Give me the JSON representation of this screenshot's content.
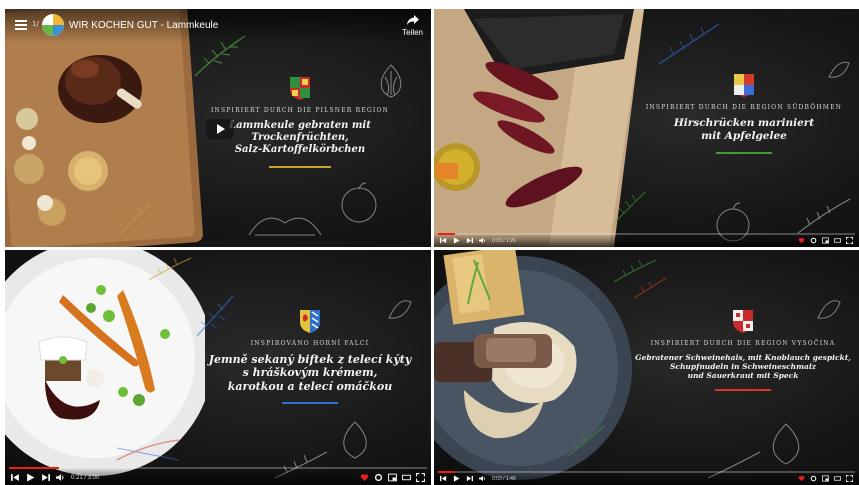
{
  "tiles": [
    {
      "id": "t1",
      "video_title": "WIR KOCHEN GUT - Lammkeule",
      "video_counter": "1/",
      "share_label": "Teilen",
      "kicker": "INSPIRIERT DURCH DIE PILSNER REGION",
      "dish_lines": [
        "Lammkeule gebraten mit Trockenfrüchten,",
        "Salz-Kartoffelkörbchen"
      ],
      "underline_color": "#c9a227"
    },
    {
      "id": "t2",
      "kicker": "INSPIRIERT DURCH DIE REGION SÜDBÖHMEN",
      "dish_lines": [
        "Hirschrücken mariniert",
        "mit Apfelgelee"
      ],
      "underline_color": "#3f9a3a",
      "time": "0:03 / 1:26",
      "progress": 0.04
    },
    {
      "id": "t3",
      "kicker": "INSPIROVÁNO HORNÍ FALCÍ",
      "dish_lines": [
        "Jemně sekaný biftek z telecí kýty",
        "s hráškovým krémem,",
        "karotkou a telecí omáčkou"
      ],
      "underline_color": "#2f6fd1",
      "time": "0:21 / 3:00",
      "progress": 0.12
    },
    {
      "id": "t4",
      "kicker": "INSPIRIERT DURCH DIE REGION VYSOČINA",
      "dish_lines": [
        "Gebratener Schweinehals, mit Knoblauch gespickt,",
        "Schupfnudeln in Schweineschmalz",
        "und Sauerkraut mit Speck"
      ],
      "underline_color": "#d33a2c",
      "time": "0:03 / 1:49",
      "progress": 0.04
    }
  ],
  "colors": {
    "yt_red": "#e62117",
    "board": "#2b2b2b"
  }
}
